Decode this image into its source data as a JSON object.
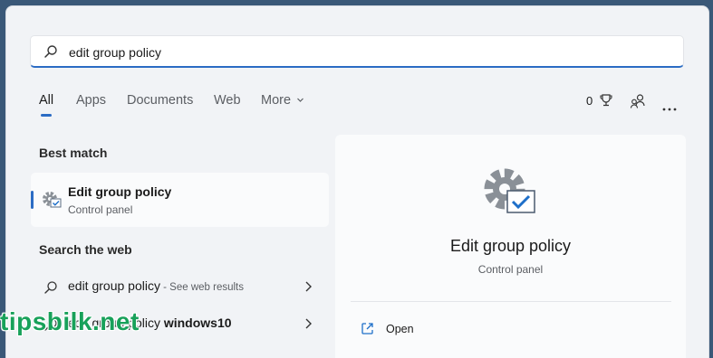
{
  "search": {
    "query": "edit group policy"
  },
  "tabs": [
    "All",
    "Apps",
    "Documents",
    "Web",
    "More"
  ],
  "toolbar": {
    "rewards_count": "0"
  },
  "best_match": {
    "heading": "Best match",
    "title": "Edit group policy",
    "subtitle": "Control panel"
  },
  "web": {
    "heading": "Search the web",
    "results": [
      {
        "text": "edit group policy",
        "hint": " - See web results"
      },
      {
        "text": "edit group policy ",
        "bold": "windows10"
      }
    ]
  },
  "detail": {
    "title": "Edit group policy",
    "subtitle": "Control panel",
    "actions": [
      {
        "label": "Open"
      }
    ]
  },
  "watermark": "tipsbilk.net",
  "colors": {
    "accent": "#2b6cc4",
    "watermark": "#18a15a"
  }
}
